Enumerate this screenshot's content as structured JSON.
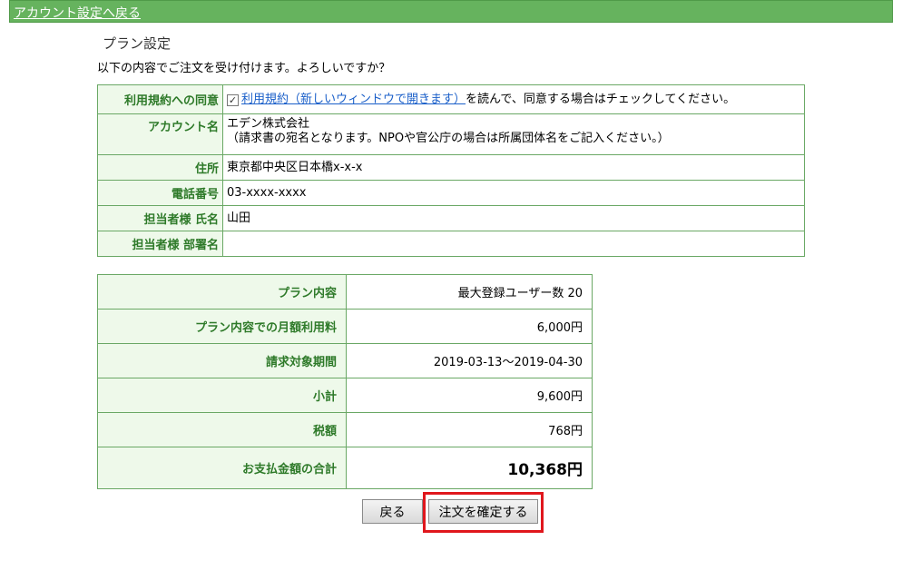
{
  "nav": {
    "back_to_account": "アカウント設定へ戻る"
  },
  "page": {
    "title": "プラン設定",
    "intro": "以下の内容でご注文を受け付けます。よろしいですか？"
  },
  "info": {
    "agree_label": "利用規約への同意",
    "agree_checked": true,
    "agree_check_mark": "☑",
    "agree_link": "利用規約（新しいウィンドウで開きます）",
    "agree_text": "を読んで、同意する場合はチェックしてください。",
    "account_label": "アカウント名",
    "account_value": "エデン株式会社",
    "account_note": "（請求書の宛名となります。NPOや官公庁の場合は所属団体名をご記入ください。）",
    "address_label": "住所",
    "address_value": "東京都中央区日本橋x-x-x",
    "phone_label": "電話番号",
    "phone_value": "03-xxxx-xxxx",
    "contact_name_label": "担当者様 氏名",
    "contact_name_value": "山田",
    "department_label": "担当者様 部署名",
    "department_value": ""
  },
  "plan": {
    "rows": [
      {
        "label": "プラン内容",
        "value": "最大登録ユーザー数 20"
      },
      {
        "label": "プラン内容での月額利用料",
        "value": "6,000円"
      },
      {
        "label": "請求対象期間",
        "value": "2019-03-13～2019-04-30"
      },
      {
        "label": "小計",
        "value": "9,600円"
      },
      {
        "label": "税額",
        "value": "768円"
      }
    ],
    "total_label": "お支払金額の合計",
    "total_value": "10,368円"
  },
  "buttons": {
    "back": "戻る",
    "confirm": "注文を確定する"
  },
  "colors": {
    "header_bar": "#66b35e",
    "label_bg": "#eef9ea",
    "label_text": "#2e7a29",
    "border": "#6aa865",
    "highlight": "#e0171d"
  }
}
